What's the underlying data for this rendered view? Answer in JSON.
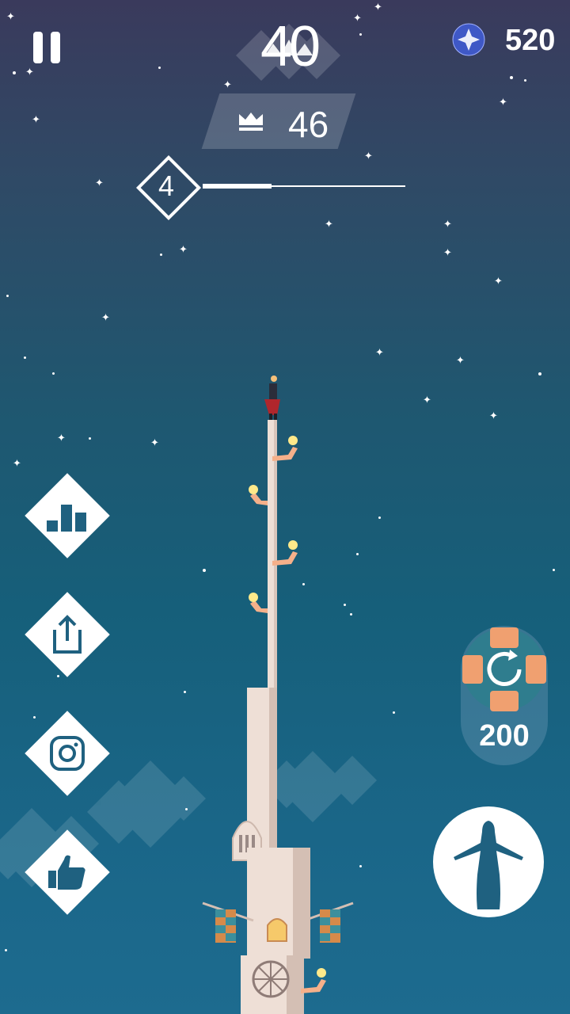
{
  "hud": {
    "score": "40",
    "best_score": "46",
    "gems": "520",
    "level": "4",
    "level_progress": 0.34
  },
  "revive": {
    "cost": "200"
  },
  "side_menu": [
    {
      "name": "leaderboard-button",
      "icon": "bar-chart-icon"
    },
    {
      "name": "share-button",
      "icon": "share-icon"
    },
    {
      "name": "instagram-button",
      "icon": "instagram-icon"
    },
    {
      "name": "like-button",
      "icon": "thumbs-up-icon"
    }
  ],
  "colors": {
    "sky_top": "#3a3a5c",
    "sky_bottom": "#1d6b8f",
    "tower": "#eedfd6",
    "torch": "#f5b08a",
    "accent_orange": "#f0a070",
    "revive_teal": "#2f7d8e"
  }
}
